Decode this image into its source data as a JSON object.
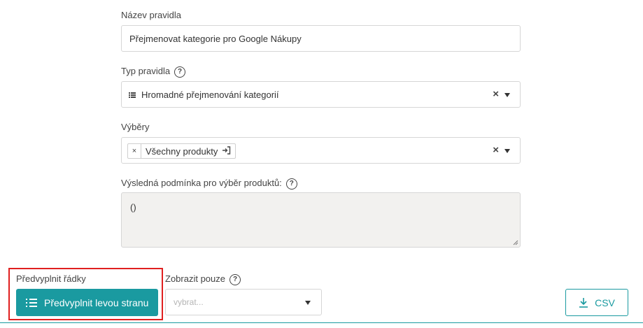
{
  "rule_name": {
    "label": "Název pravidla",
    "value": "Přejmenovat kategorie pro Google Nákupy"
  },
  "rule_type": {
    "label": "Typ pravidla",
    "help": "?",
    "value": "Hromadné přejmenování kategorií",
    "clear": "×"
  },
  "selections": {
    "label": "Výběry",
    "chip_remove": "×",
    "chip_label": "Všechny produkty",
    "clear": "×"
  },
  "condition": {
    "label": "Výsledná podmínka pro výběr produktů:",
    "help": "?",
    "value": "()"
  },
  "prefill": {
    "label": "Předvyplnit řádky",
    "button_label": "Předvyplnit levou stranu"
  },
  "show_only": {
    "label": "Zobrazit pouze",
    "help": "?",
    "placeholder": "vybrat..."
  },
  "export": {
    "csv_label": "CSV"
  },
  "colors": {
    "accent": "#1a9aa0",
    "highlight": "#e02020"
  }
}
